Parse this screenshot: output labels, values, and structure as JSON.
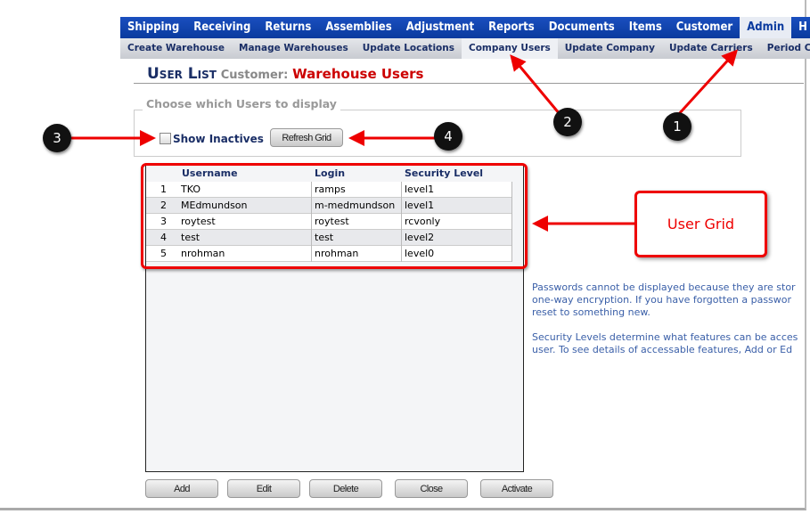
{
  "nav": {
    "items": [
      "Shipping",
      "Receiving",
      "Returns",
      "Assemblies",
      "Adjustment",
      "Reports",
      "Documents",
      "Items",
      "Customer",
      "Admin",
      "H"
    ],
    "active": "Admin"
  },
  "subnav": {
    "items": [
      "Create Warehouse",
      "Manage Warehouses",
      "Update Locations",
      "Company Users",
      "Update Company",
      "Update Carriers",
      "Period Close"
    ],
    "active": "Company Users"
  },
  "title": {
    "main": "User List",
    "label": "Customer:",
    "value": "Warehouse Users"
  },
  "filter": {
    "legend": "Choose which Users to display",
    "show_inactives_label": "Show Inactives",
    "show_inactives_checked": false,
    "refresh_label": "Refresh Grid"
  },
  "grid": {
    "columns": [
      "Username",
      "Login",
      "Security Level"
    ],
    "rows": [
      {
        "num": "1",
        "username": "TKO",
        "login": "ramps",
        "level": "level1"
      },
      {
        "num": "2",
        "username": "MEdmundson",
        "login": "m-medmundson",
        "level": "level1"
      },
      {
        "num": "3",
        "username": "roytest",
        "login": "roytest",
        "level": "rcvonly"
      },
      {
        "num": "4",
        "username": "test",
        "login": "test",
        "level": "level2"
      },
      {
        "num": "5",
        "username": "nrohman",
        "login": "nrohman",
        "level": "level0"
      }
    ]
  },
  "info": {
    "lines": [
      "Passwords cannot be displayed because they are stor",
      "one-way encryption. If you have forgotten a passwor",
      "reset to something new.",
      "",
      "Security Levels determine what features can be acces",
      "user. To see details of accessable features, Add or Ed"
    ]
  },
  "buttons": {
    "add": "Add",
    "edit": "Edit",
    "delete": "Delete",
    "close": "Close",
    "activate": "Activate"
  },
  "annotations": {
    "c1": "1",
    "c2": "2",
    "c3": "3",
    "c4": "4",
    "callout": "User Grid"
  },
  "colors": {
    "nav": "#0a3a9e",
    "annotation": "#e00000"
  }
}
